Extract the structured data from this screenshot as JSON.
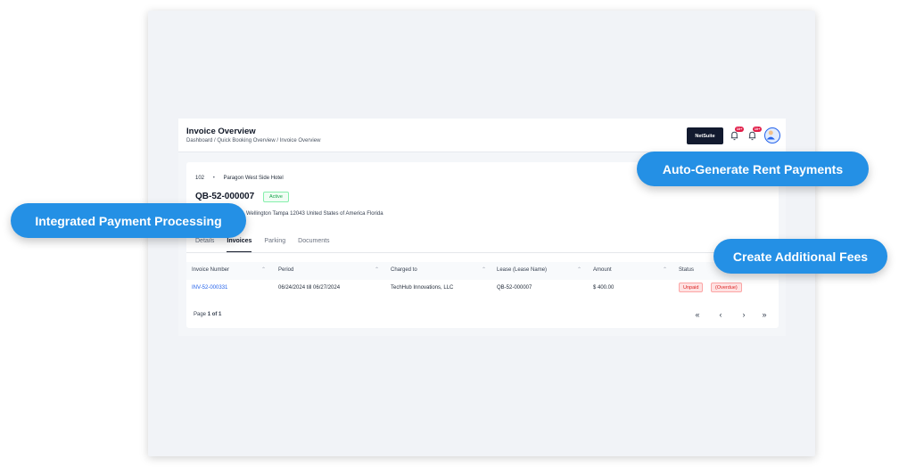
{
  "header": {
    "title": "Invoice Overview",
    "breadcrumb": "Dashboard / Quick Booking Overview / Invoice Overview",
    "netsuite_label": "NetSuite",
    "notif_badge_1": "10+",
    "notif_badge_2": "10+"
  },
  "property": {
    "unit": "102",
    "separator": "•",
    "name": "Paragon West Side Hotel",
    "lease_id": "QB-52-000007",
    "status": "Active",
    "address": "Wellington Tampa 12043 United States of America Florida"
  },
  "tabs": [
    {
      "label": "Details"
    },
    {
      "label": "Invoices"
    },
    {
      "label": "Parking"
    },
    {
      "label": "Documents"
    }
  ],
  "table": {
    "columns": [
      "Invoice Number",
      "Period",
      "Charged to",
      "Lease (Lease Name)",
      "Amount",
      "Status"
    ],
    "rows": [
      {
        "invoice_number": "INV-52-000331",
        "period": "06/24/2024 till 06/27/2024",
        "charged_to": "TechHub Innovations, LLC",
        "lease": "QB-52-000007",
        "amount": "$ 400.00",
        "status_1": "Unpaid",
        "status_2": "(Overdue)"
      }
    ]
  },
  "pagination": {
    "prefix": "Page",
    "current": "1 of 1",
    "first": "«",
    "prev": "‹",
    "next": "›",
    "last": "»"
  },
  "callouts": {
    "auto_generate": "Auto-Generate Rent Payments",
    "integrated": "Integrated Payment Processing",
    "additional_fees": "Create Additional Fees"
  },
  "colors": {
    "accent": "#2490e5",
    "netsuite_bg": "#121a2f",
    "status_active": "#16a34a",
    "status_unpaid": "#dc2626"
  }
}
